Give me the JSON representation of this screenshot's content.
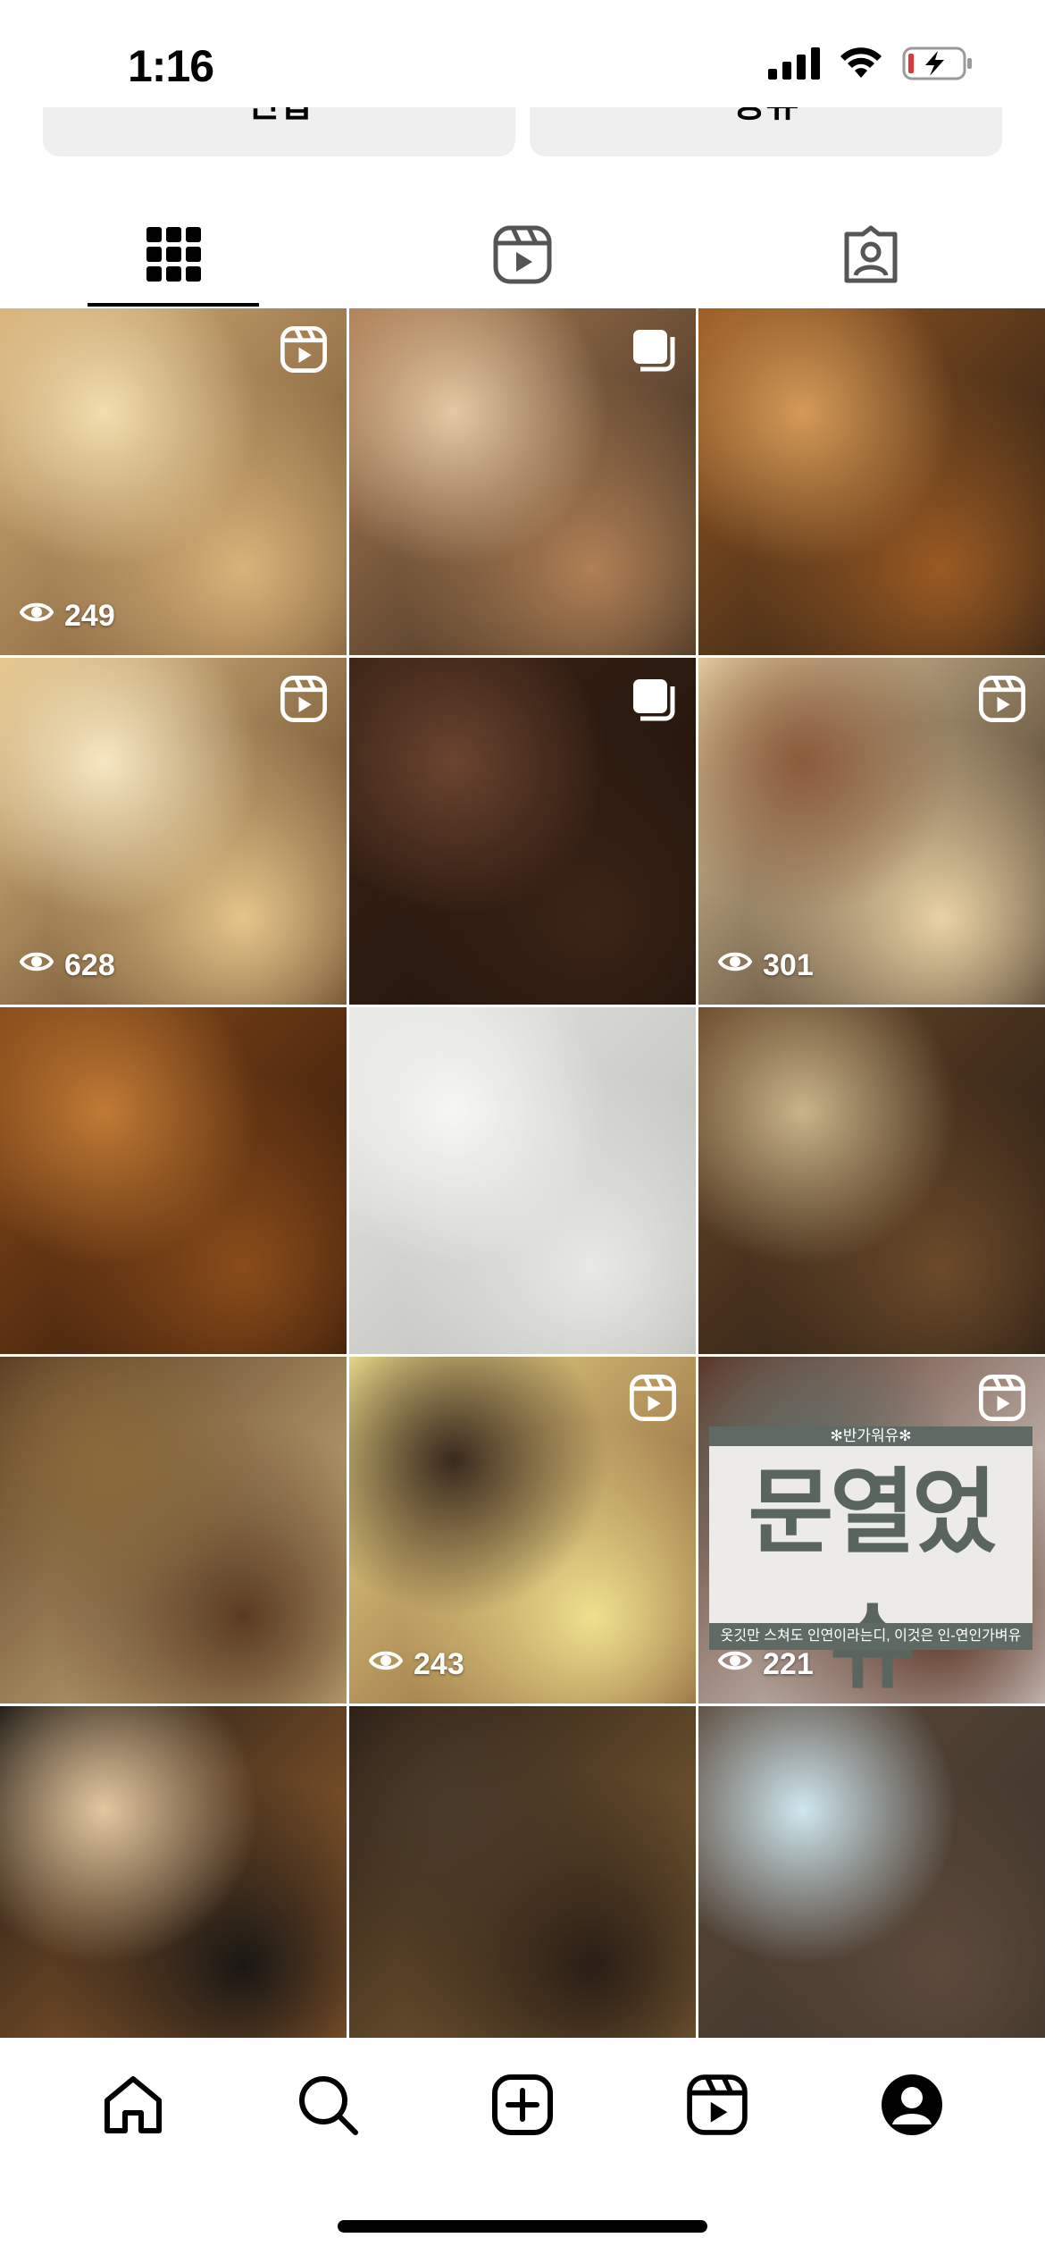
{
  "status_bar": {
    "time": "1:16"
  },
  "profile_buttons": [
    {
      "label": "편집"
    },
    {
      "label": "공유"
    }
  ],
  "tabs": [
    {
      "name": "posts",
      "icon": "grid-icon",
      "active": true
    },
    {
      "name": "reels",
      "icon": "reels-icon",
      "active": false
    },
    {
      "name": "tagged",
      "icon": "tagged-icon",
      "active": false
    }
  ],
  "grid": [
    {
      "desc": "cream dessert with fork",
      "type": "reel",
      "views": "249",
      "palette": [
        "#d8b37a",
        "#6b4a2b",
        "#f2ddae"
      ]
    },
    {
      "desc": "latte art coffee",
      "type": "carousel",
      "views": "",
      "palette": [
        "#b08056",
        "#2c2117",
        "#e5c8a3"
      ]
    },
    {
      "desc": "almond financiers",
      "type": "",
      "views": "",
      "palette": [
        "#9a5a23",
        "#1d1712",
        "#d49a58"
      ]
    },
    {
      "desc": "cake over cream",
      "type": "reel",
      "views": "628",
      "palette": [
        "#e5c58a",
        "#4a2a13",
        "#f6e7c2"
      ]
    },
    {
      "desc": "coffee beans",
      "type": "carousel",
      "views": "",
      "palette": [
        "#3b2416",
        "#1b100a",
        "#6b4430"
      ]
    },
    {
      "desc": "chocolate cake over cream",
      "type": "reel",
      "views": "301",
      "palette": [
        "#e9d2a4",
        "#2d1d14",
        "#8a5a3b"
      ]
    },
    {
      "desc": "caramel pastries",
      "type": "",
      "views": "",
      "palette": [
        "#8a4c1a",
        "#2a1308",
        "#c07a35"
      ]
    },
    {
      "desc": "stacked white boxes",
      "type": "",
      "views": "",
      "palette": [
        "#e8e8e6",
        "#b5b5b2",
        "#f6f6f4"
      ]
    },
    {
      "desc": "assorted cakes",
      "type": "",
      "views": "",
      "palette": [
        "#6b4a2a",
        "#1e150f",
        "#c9b48a"
      ]
    },
    {
      "desc": "financier assortment",
      "type": "",
      "views": "",
      "palette": [
        "#5a3b22",
        "#d9c08a",
        "#8a6a3a"
      ]
    },
    {
      "desc": "cream sandwich cake",
      "type": "reel",
      "views": "243",
      "palette": [
        "#efe08e",
        "#7a4a2a",
        "#3a2a1e"
      ]
    },
    {
      "desc": "opening sign",
      "type": "reel",
      "views": "221",
      "palette": [
        "#5a3324",
        "#ecebe8",
        "#5f6a64"
      ],
      "sign": {
        "top": "✻반가워유✻",
        "main": "문열었슈",
        "sub": "옷깃만 스쳐도 인연이라는디, 이것은 인-연인가벼유"
      }
    },
    {
      "desc": "nut financiers tray",
      "type": "",
      "views": "",
      "palette": [
        "#1a1714",
        "#a86a32",
        "#e2c7a0"
      ]
    },
    {
      "desc": "chocolate pastries",
      "type": "",
      "views": "",
      "palette": [
        "#2a1d15",
        "#8a6a3a",
        "#4a3a2a"
      ]
    },
    {
      "desc": "blue soda drink",
      "type": "",
      "views": "",
      "palette": [
        "#5c4a3c",
        "#3a2f25",
        "#cfe7ef"
      ]
    }
  ],
  "nav": [
    {
      "name": "home",
      "icon": "home-icon"
    },
    {
      "name": "search",
      "icon": "search-icon"
    },
    {
      "name": "create",
      "icon": "add-post-icon"
    },
    {
      "name": "reels",
      "icon": "reels-icon"
    },
    {
      "name": "profile",
      "icon": "profile-icon"
    }
  ]
}
